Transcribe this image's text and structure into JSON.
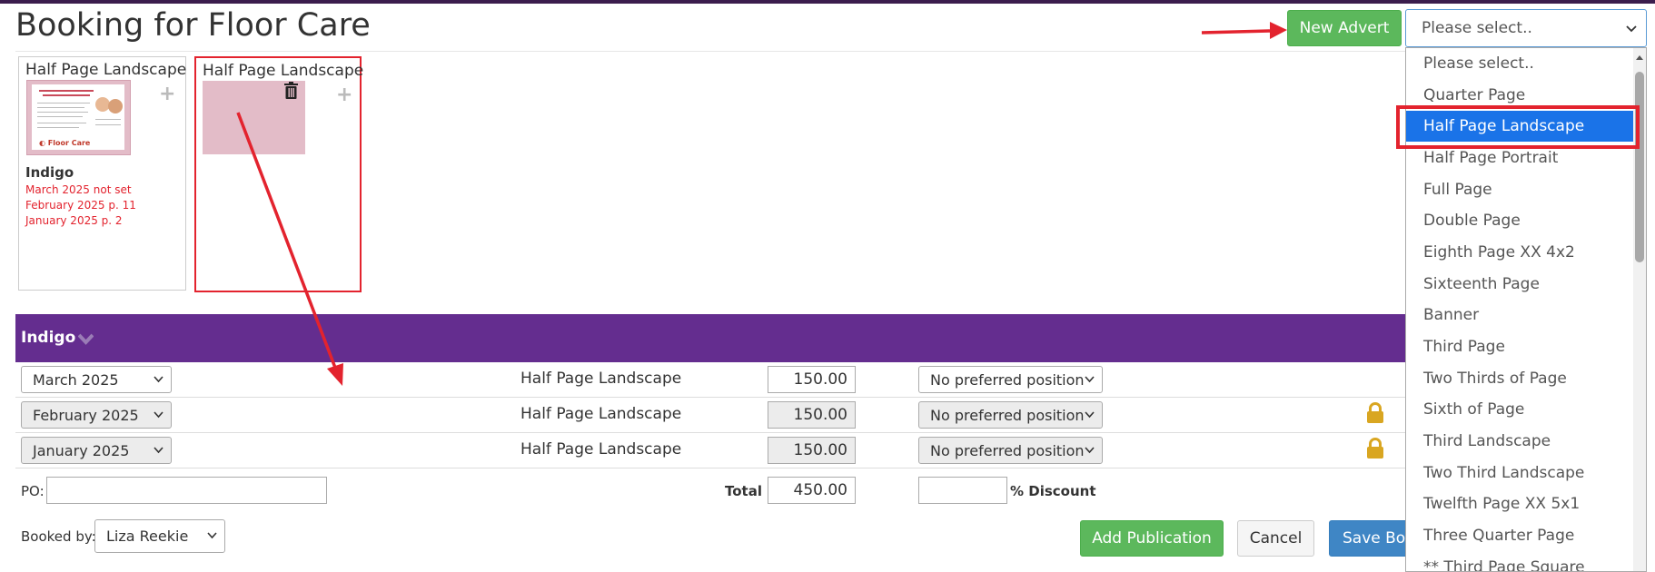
{
  "page": {
    "title": "Booking for Floor Care"
  },
  "toolbar": {
    "new_advert_label": "New Advert",
    "size_select_value": "Please select.."
  },
  "adverts": [
    {
      "type": "Half Page Landscape",
      "publication": "Indigo",
      "bookings": [
        "March 2025 not set",
        "February 2025 p. 11",
        "January 2025 p. 2"
      ]
    },
    {
      "type": "Half Page Landscape"
    }
  ],
  "publication": {
    "name": "Indigo",
    "rows": [
      {
        "month": "March 2025",
        "type": "Half Page Landscape",
        "price": "150.00",
        "position": "No preferred position",
        "locked": false
      },
      {
        "month": "February 2025",
        "type": "Half Page Landscape",
        "price": "150.00",
        "position": "No preferred position",
        "locked": true
      },
      {
        "month": "January 2025",
        "type": "Half Page Landscape",
        "price": "150.00",
        "position": "No preferred position",
        "locked": true
      }
    ]
  },
  "footer": {
    "po_label": "PO:",
    "po_value": "",
    "total_label": "Total",
    "total_value": "450.00",
    "discount_value": "",
    "discount_label": "% Discount",
    "booked_by_label": "Booked by:",
    "booked_by_value": "Liza Reekie",
    "add_publication_label": "Add Publication",
    "cancel_label": "Cancel",
    "save_label": "Save Booking"
  },
  "dropdown": {
    "selected": "Half Page Landscape",
    "options": [
      "Please select..",
      "Quarter Page",
      "Half Page Landscape",
      "Half Page Portrait",
      "Full Page",
      "Double Page",
      "Eighth Page XX 4x2",
      "Sixteenth Page",
      "Banner",
      "Third Page",
      "Two Thirds of Page",
      "Sixth of Page",
      "Third Landscape",
      "Two Third Landscape",
      "Twelfth Page XX 5x1",
      "Three Quarter Page",
      "** Third Page Square"
    ]
  },
  "colors": {
    "accent_purple": "#642d8f",
    "success_green": "#5cb85c",
    "primary_blue": "#3f86c5",
    "annotation_red": "#e3232e",
    "lock_gold": "#d9a621"
  },
  "icons": [
    "plus-icon",
    "trash-icon",
    "chevron-down-icon",
    "lock-icon"
  ]
}
